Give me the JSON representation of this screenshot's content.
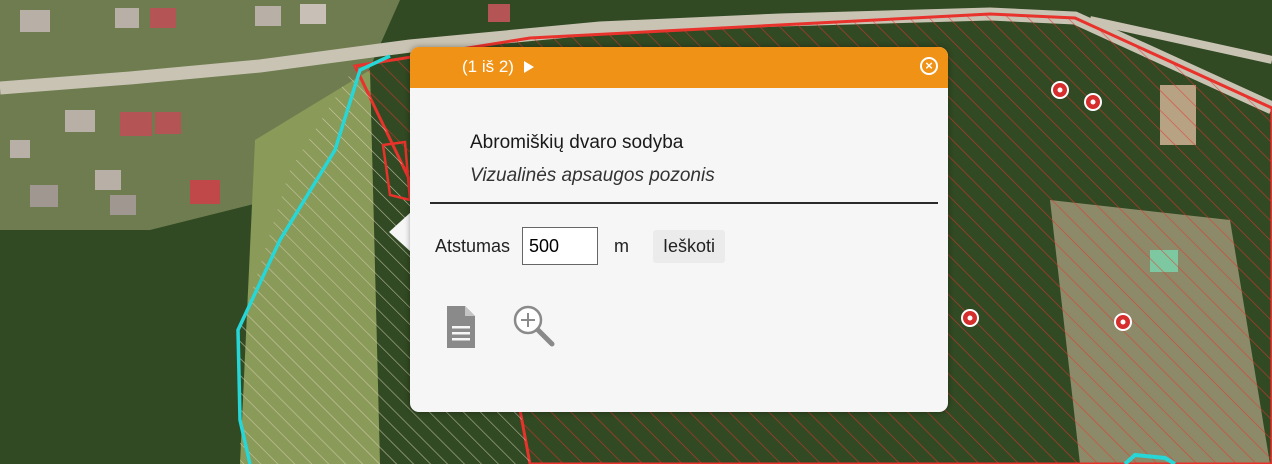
{
  "map": {
    "colors": {
      "boundary_red": "#e8322c",
      "boundary_cyan": "#27d6d6",
      "road": "#c9c3b4",
      "forest": "#2f4a22",
      "field": "#8a9a58"
    }
  },
  "popup": {
    "pager_label": "(1 iš 2)",
    "title": "Abromiškių dvaro sodyba",
    "subtitle": "Vizualinės apsaugos pozonis",
    "distance_label": "Atstumas",
    "distance_value": "500",
    "unit_label": "m",
    "search_label": "Ieškoti",
    "accent": "#ef9215",
    "icons": {
      "next": "next-arrow-icon",
      "close": "close-icon",
      "document": "document-icon",
      "zoom": "zoom-in-icon"
    }
  }
}
